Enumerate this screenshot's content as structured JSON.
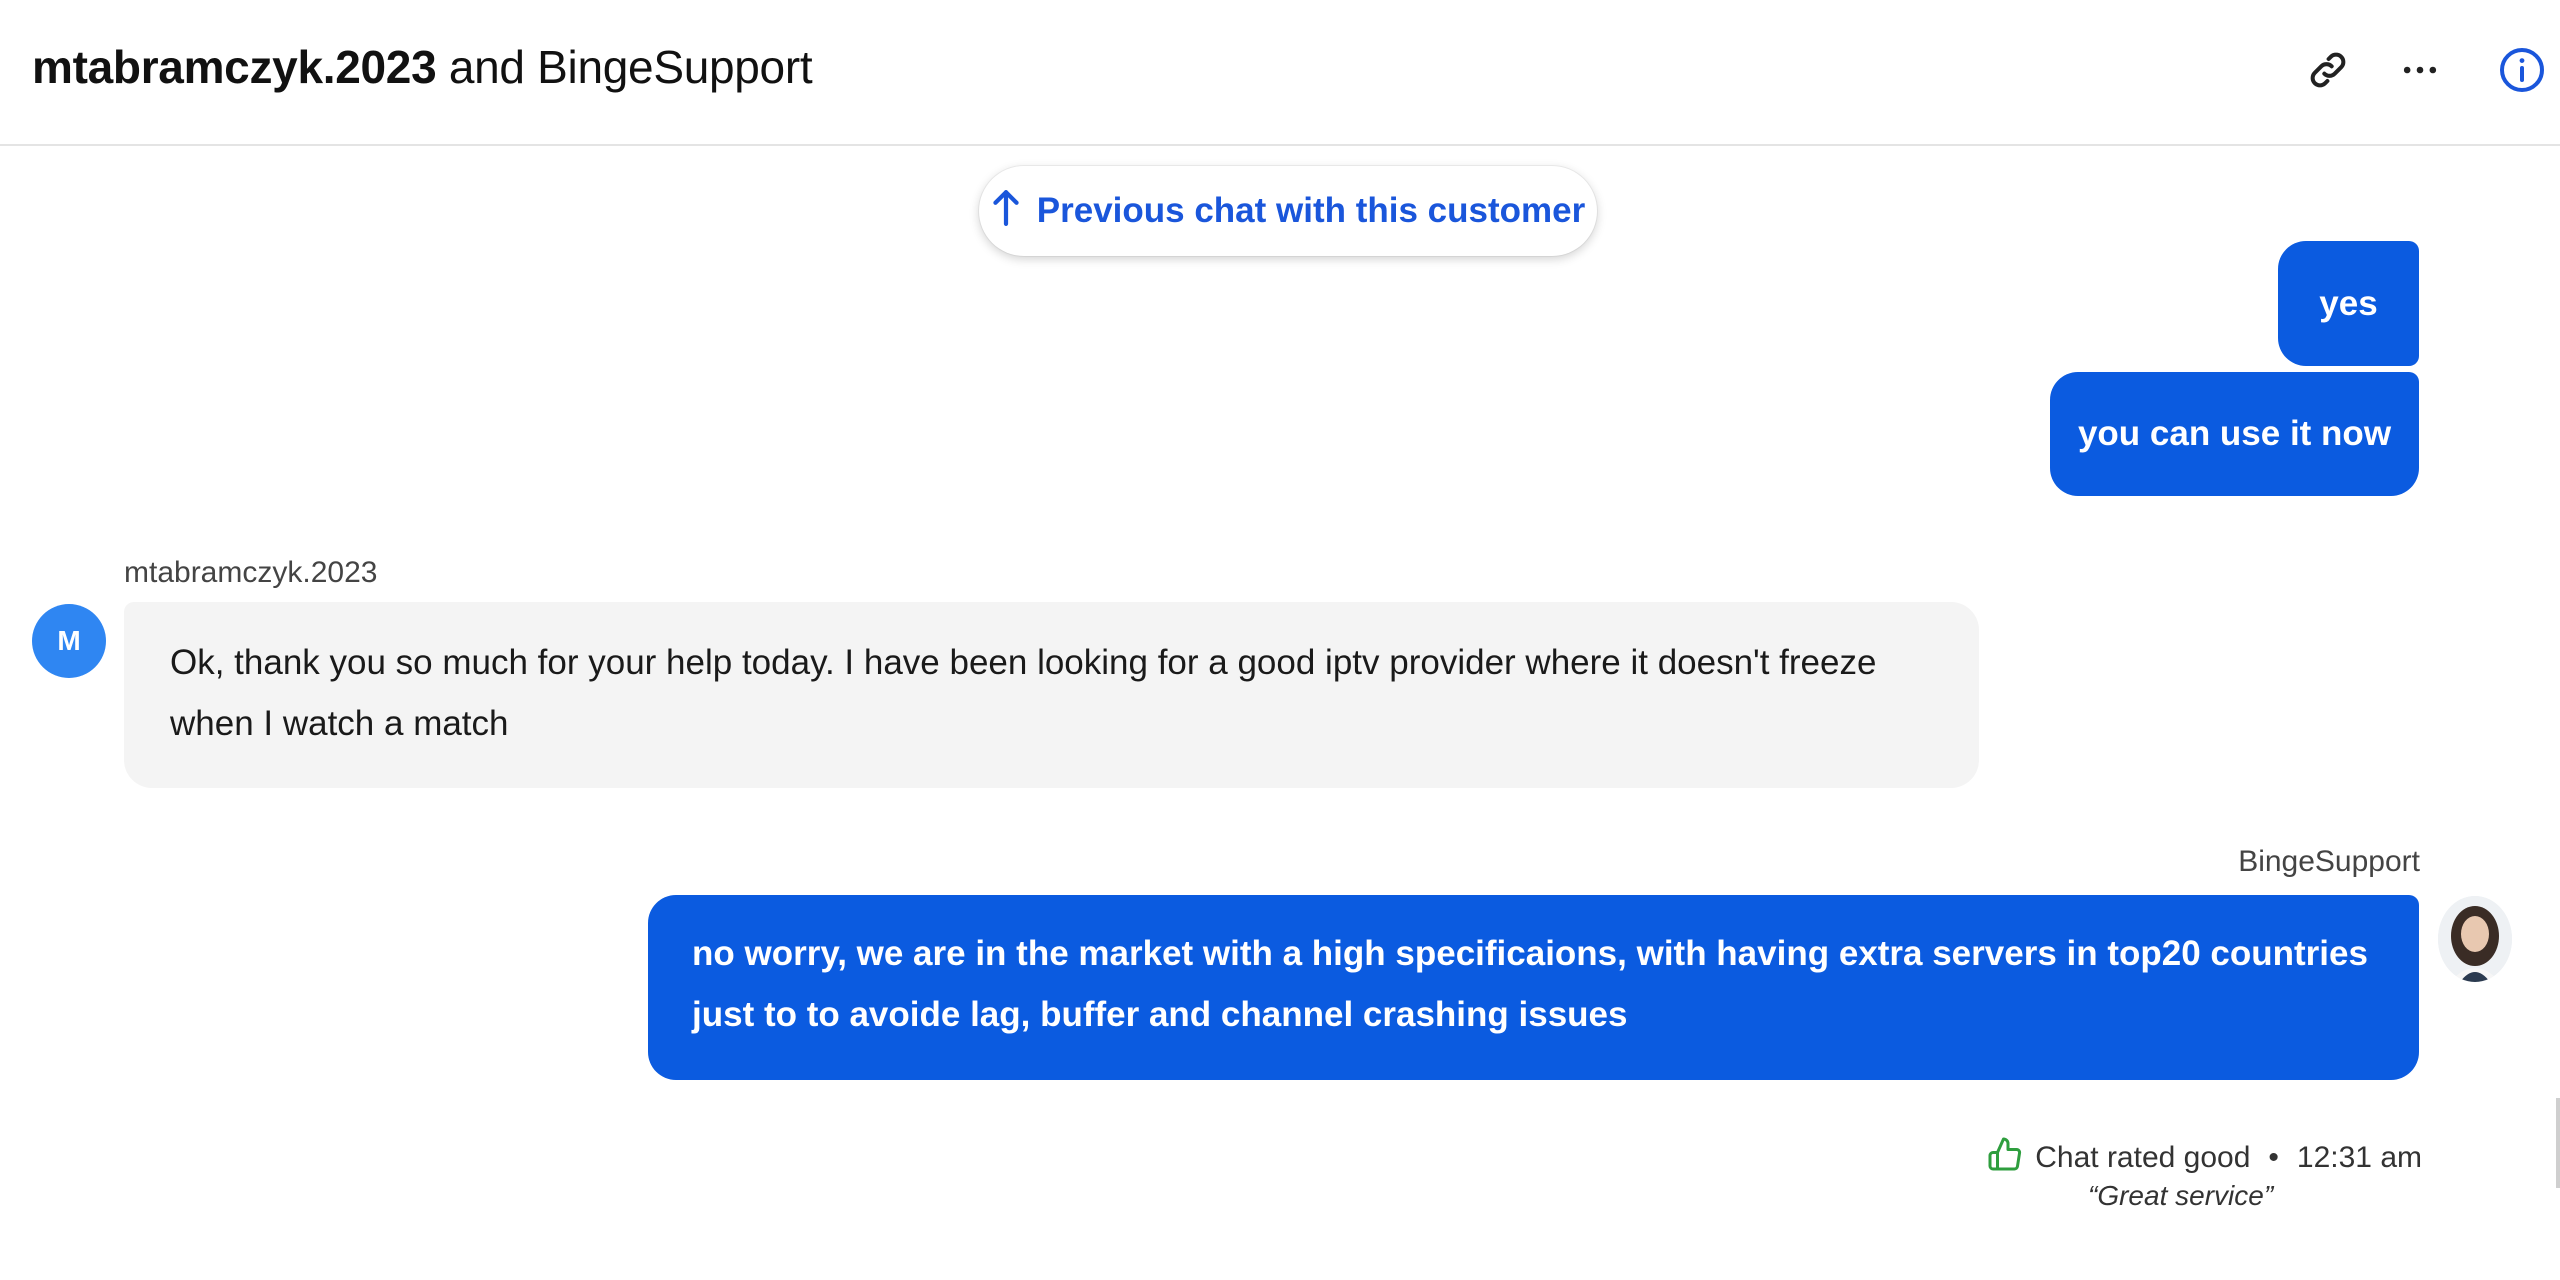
{
  "header": {
    "title_customer": "mtabramczyk.2023",
    "title_joiner": " and ",
    "title_agent": "BingeSupport",
    "icons": [
      "link-icon",
      "more-icon",
      "info-icon"
    ]
  },
  "previous_chat": {
    "label": "Previous chat with this customer",
    "icon": "arrow-up-icon"
  },
  "messages": [
    {
      "sender": "agent",
      "text": "yes"
    },
    {
      "sender": "agent",
      "text": "you can use it now"
    },
    {
      "sender": "customer",
      "sender_label": "mtabramczyk.2023",
      "avatar_initial": "M",
      "text": "Ok, thank you so much for your help today. I have been looking for a good iptv provider where it doesn't freeze when I watch a match"
    },
    {
      "sender": "agent",
      "sender_label": "BingeSupport",
      "text": "no worry, we are in the market with a high specificaions, with having extra servers in top20 countries just to to avoide lag, buffer and channel crashing issues"
    }
  ],
  "rating": {
    "label": "Chat rated good",
    "separator": "•",
    "time": "12:31 am",
    "comment": "“Great service”",
    "icon": "thumbs-up-icon"
  },
  "colors": {
    "agent_bubble": "#0b5be0",
    "accent_blue": "#1a56db",
    "customer_bubble": "#f4f4f4",
    "avatar_blue": "#2f86f2",
    "rating_green": "#2e9e3e"
  }
}
